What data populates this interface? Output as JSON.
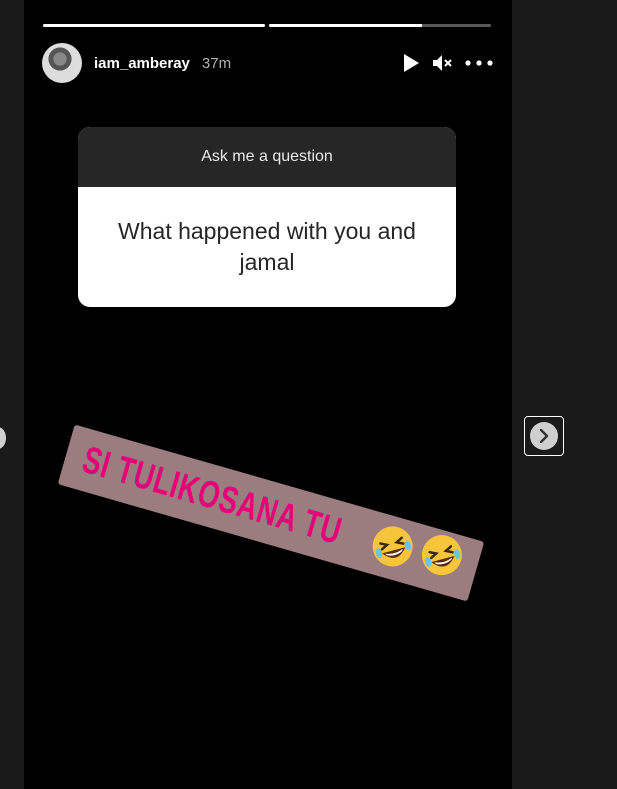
{
  "story": {
    "progress": [
      1.0,
      0.69
    ],
    "user": {
      "username": "iam_amberay",
      "time": "37m"
    },
    "controls": {
      "play_icon": "play-icon",
      "mute_icon": "muted-speaker-icon",
      "more_icon": "more-horizontal-icon"
    },
    "question_card": {
      "header": "Ask me a question",
      "question": "What happened with you and jamal"
    },
    "sticker": {
      "text": "SI TULIKOSANA TU",
      "emoji": "🤣🤣"
    }
  },
  "nav": {
    "next_icon": "chevron-right-icon",
    "prev_icon": "chevron-left-icon"
  },
  "colors": {
    "background": "#1a1a1a",
    "story_bg": "#000000",
    "sticker_bg": "#9b7d7f",
    "sticker_text": "#e5007a"
  }
}
